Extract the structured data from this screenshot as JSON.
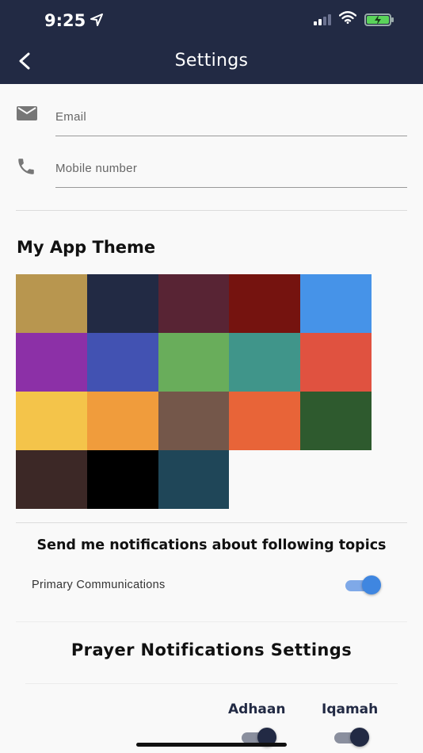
{
  "status_bar": {
    "time": "9:25"
  },
  "header": {
    "title": "Settings"
  },
  "form": {
    "email_placeholder": "Email",
    "mobile_placeholder": "Mobile number"
  },
  "theme": {
    "title": "My App Theme",
    "colors": [
      "#b8964f",
      "#222a44",
      "#582434",
      "#75130f",
      "#4693e8",
      "#8c30a7",
      "#4252b2",
      "#69ad5b",
      "#40958a",
      "#e05240",
      "#f4c44a",
      "#f09c3c",
      "#74574a",
      "#e86438",
      "#2e5a2e",
      "#3c2826",
      "#000000",
      "#1f4658"
    ]
  },
  "notifications": {
    "title": "Send me notifications about following topics",
    "items": [
      {
        "label": "Primary Communications",
        "on": true
      }
    ]
  },
  "prayer": {
    "title": "Prayer Notifications Settings",
    "columns": [
      "Adhaan",
      "Iqamah"
    ]
  },
  "colors": {
    "header_bg": "#222a44",
    "toggle_blue_track": "#7fa9e8",
    "toggle_blue_knob": "#3f86e0",
    "toggle_dark_track": "#8a8f9e",
    "toggle_dark_knob": "#222a44"
  },
  "icons": {
    "back": "chevron-left-icon",
    "email": "mail-icon",
    "phone": "phone-icon",
    "location": "location-arrow-icon",
    "wifi": "wifi-icon",
    "battery": "battery-charging-icon"
  }
}
